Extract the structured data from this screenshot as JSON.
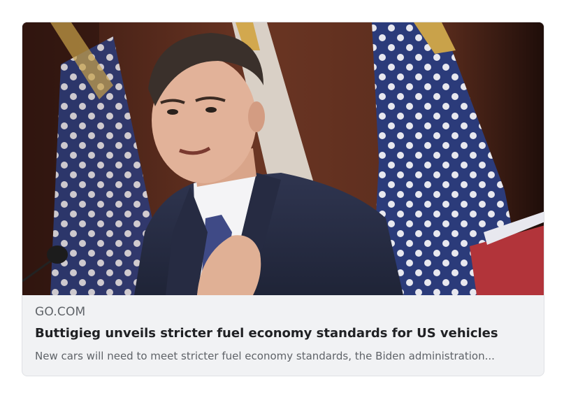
{
  "article": {
    "source": "GO.COM",
    "headline": "Buttigieg unveils stricter fuel economy standards for US vehicles",
    "snippet": "New cars will need to meet stricter fuel economy standards, the Biden administration..."
  },
  "colors": {
    "card_background": "#f1f2f4",
    "headline": "#202124",
    "secondary_text": "#5f6368",
    "flag_blue": "#2b3b7a",
    "flag_red": "#b2343a"
  }
}
